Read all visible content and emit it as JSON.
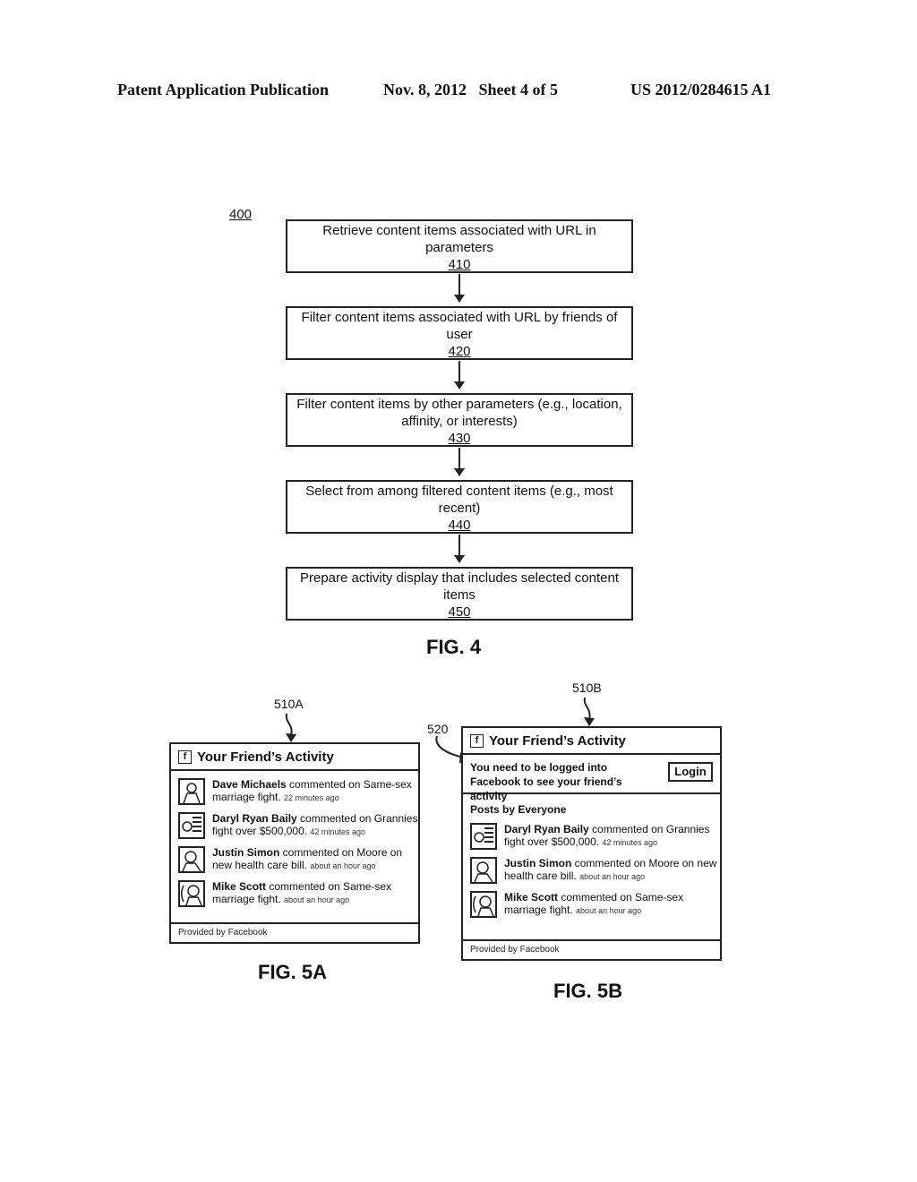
{
  "header": {
    "publication": "Patent Application Publication",
    "date_sheet": "Nov. 8, 2012   Sheet 4 of 5",
    "number": "US 2012/0284615 A1"
  },
  "fig4": {
    "ref": "400",
    "steps": [
      {
        "text": "Retrieve content items associated with URL in parameters",
        "num": "410"
      },
      {
        "text": "Filter content items associated with URL by friends of user",
        "num": "420"
      },
      {
        "text": "Filter content items by other parameters (e.g., location, affinity, or interests)",
        "num": "430"
      },
      {
        "text": "Select from among filtered content items (e.g., most recent)",
        "num": "440"
      },
      {
        "text": "Prepare activity display that includes selected content items",
        "num": "450"
      }
    ],
    "label": "FIG. 4"
  },
  "fig5a": {
    "ref": "510A",
    "title": "Your Friend’s Activity",
    "fb_glyph": "f",
    "items": [
      {
        "name": "Dave Michaels",
        "action": " commented on Same-sex marriage fight.",
        "time": "22 minutes ago"
      },
      {
        "name": "Daryl Ryan Baily",
        "action": " commented on Grannies fight over $500,000.",
        "time": "42 minutes ago"
      },
      {
        "name": "Justin Simon",
        "action": " commented on Moore on new health care bill.",
        "time": "about an hour ago"
      },
      {
        "name": "Mike Scott",
        "action": " commented on Same-sex marriage fight.",
        "time": "about an hour ago"
      }
    ],
    "footer": "Provided by Facebook",
    "label": "FIG. 5A"
  },
  "fig5b": {
    "ref": "510B",
    "ref_login": "520",
    "title": "Your Friend’s Activity",
    "fb_glyph": "f",
    "login_message": "You need to be logged into Facebook to see your friend’s activity",
    "login_button": "Login",
    "section": "Posts by Everyone",
    "items": [
      {
        "name": "Daryl Ryan Baily",
        "action": " commented on Grannies fight over $500,000.",
        "time": "42 minutes ago"
      },
      {
        "name": "Justin Simon",
        "action": " commented on Moore on new health care bill.",
        "time": "about an hour ago"
      },
      {
        "name": "Mike Scott",
        "action": " commented on Same-sex marriage fight.",
        "time": "about an hour ago"
      }
    ],
    "footer": "Provided by Facebook",
    "label": "FIG. 5B"
  }
}
